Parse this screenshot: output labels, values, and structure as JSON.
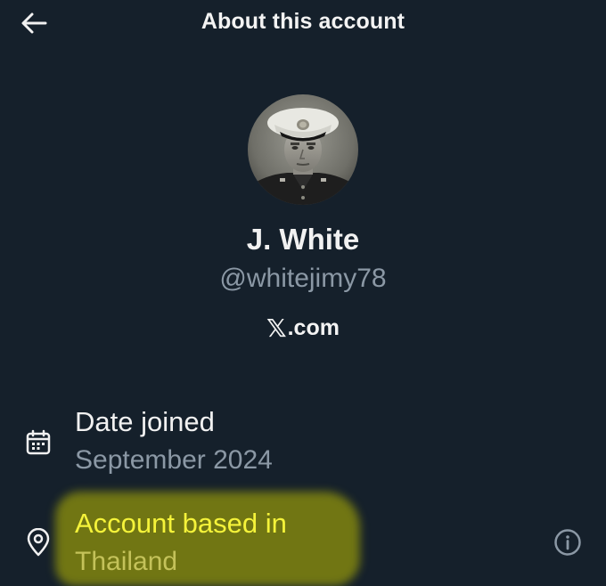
{
  "header": {
    "title": "About this account",
    "back_icon": "arrow-left-icon"
  },
  "profile": {
    "display_name": "J. White",
    "handle": "@whitejimy78",
    "source": {
      "logo_text": "𝕏",
      "suffix": ".com"
    }
  },
  "details": {
    "date_joined": {
      "label": "Date joined",
      "value": "September 2024",
      "icon": "calendar-icon"
    },
    "based_in": {
      "label": "Account based in",
      "value": "Thailand",
      "icon": "location-pin-icon",
      "info_icon": "info-icon"
    }
  },
  "colors": {
    "background": "#15202b",
    "primary_text": "#e7e9ea",
    "secondary_text": "#8b98a5",
    "highlight": "#bebe00"
  }
}
